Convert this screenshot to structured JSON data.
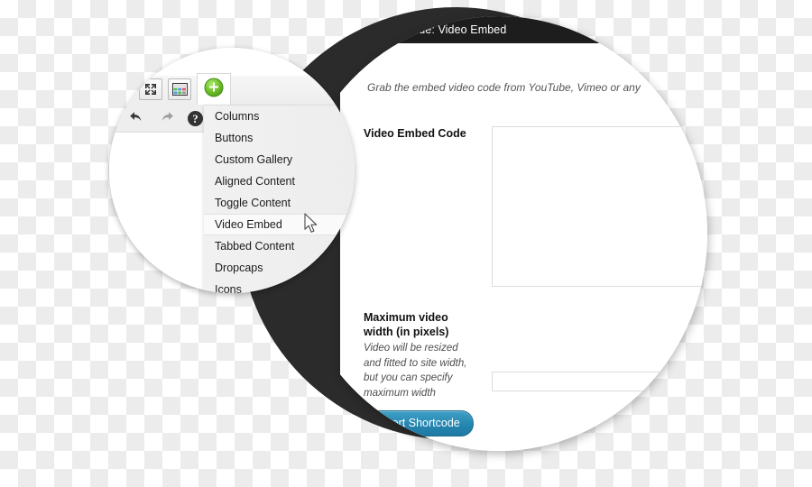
{
  "modal": {
    "title": "Insert Shortcode: Video Embed",
    "hint": "Grab the embed video code from YouTube, Vimeo or any",
    "fields": [
      {
        "label": "Video Embed Code",
        "description": "",
        "value": "",
        "placeholder": ""
      },
      {
        "label": "Maximum video width (in pixels)",
        "description": "Video will be resized and fitted to site width, but you can specify maximum width",
        "value": "",
        "placeholder": ""
      }
    ],
    "submit_label": "Insert Shortcode",
    "colors": {
      "titlebar_bg": "#1d1d1d",
      "button_bg": "#2586b0",
      "dark_circle": "#2b2b2b",
      "panel_bg": "#ffffff"
    }
  },
  "editor": {
    "toolbar": {
      "buttons": [
        {
          "name": "fullscreen",
          "title": "Fullscreen"
        },
        {
          "name": "table",
          "title": "Table"
        },
        {
          "name": "add-shortcode",
          "title": "Insert Shortcode"
        },
        {
          "name": "undo",
          "title": "Undo"
        },
        {
          "name": "redo",
          "title": "Redo"
        },
        {
          "name": "help",
          "title": "Help"
        }
      ]
    },
    "dropdown": {
      "active_index": 5,
      "items": [
        "Columns",
        "Buttons",
        "Custom Gallery",
        "Aligned Content",
        "Toggle Content",
        "Video Embed",
        "Tabbed Content",
        "Dropcaps",
        "Icons"
      ]
    }
  }
}
